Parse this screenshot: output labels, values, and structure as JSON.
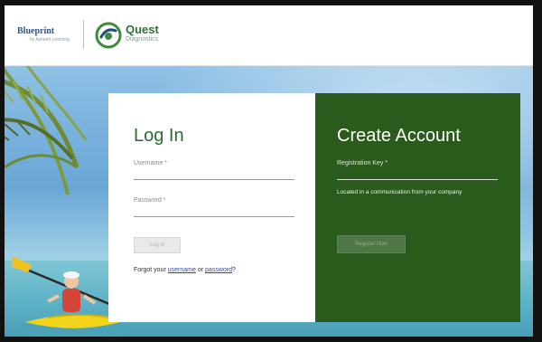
{
  "header": {
    "blueprint_logo": "Blueprint",
    "blueprint_tagline": "by Ascend Learning",
    "quest_logo": "Quest",
    "quest_tagline": "Diagnostics"
  },
  "login": {
    "title": "Log In",
    "username_placeholder": "Username *",
    "password_placeholder": "Password *",
    "button_label": "Log In",
    "forgot_prefix": "Forgot your",
    "forgot_username": "username",
    "forgot_or": "or",
    "forgot_password": "password",
    "forgot_suffix": "?"
  },
  "create": {
    "title": "Create Account",
    "key_placeholder": "Registration Key *",
    "key_hint": "Located in a communication from your company",
    "button_label": "Register Now"
  },
  "colors": {
    "brand_green": "#2a5a1c",
    "title_green": "#2d6b2e",
    "link_blue": "#2b4da0"
  },
  "icons": {
    "quest_logo_icon": "quest-swirl-icon"
  }
}
